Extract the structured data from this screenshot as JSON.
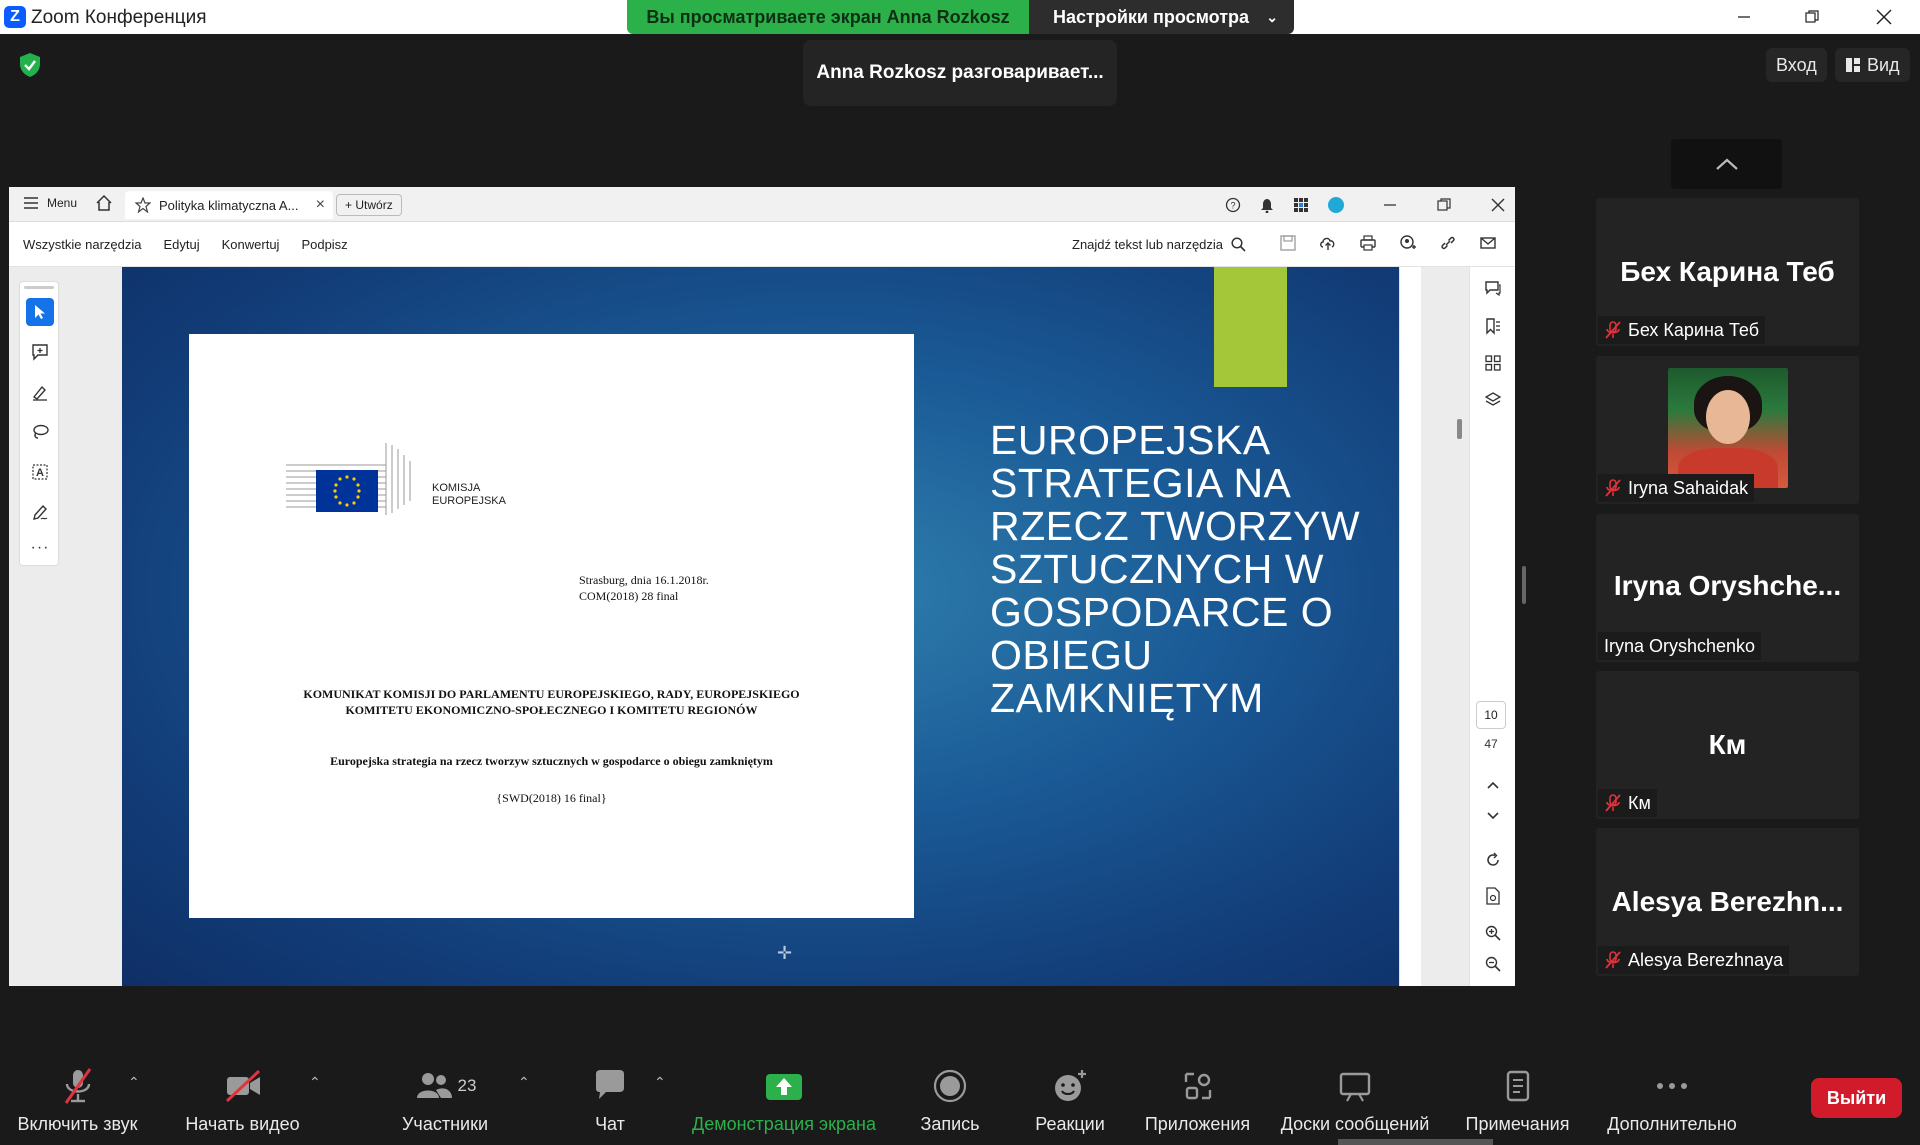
{
  "window": {
    "title": "Zoom Конференция"
  },
  "share_banner": {
    "viewing": "Вы просматриваете экран Anna Rozkosz",
    "view_settings": "Настройки просмотра"
  },
  "toast": {
    "speaking": "Anna Rozkosz разговаривает..."
  },
  "top_right": {
    "signin": "Вход",
    "view": "Вид"
  },
  "acrobat": {
    "menu": "Menu",
    "tab_title": "Polityka klimatyczna A...",
    "create": "Utwórz",
    "tools": [
      "Wszystkie narzędzia",
      "Edytuj",
      "Konwertuj",
      "Podpisz"
    ],
    "find_placeholder": "Znajdź tekst lub narzędzia",
    "page_current": "10",
    "page_total": "47"
  },
  "slide": {
    "title": "EUROPEJSKA STRATEGIA NA RZECZ TWORZYW SZTUCZNYCH W GOSPODARCE O OBIEGU ZAMKNIĘTYM",
    "accent_color": "#a4c639"
  },
  "document": {
    "logo_line1": "KOMISJA",
    "logo_line2": "EUROPEJSKA",
    "place_date": "Strasburg, dnia 16.1.2018r.",
    "doc_code": "COM(2018) 28 final",
    "heading": "KOMUNIKAT KOMISJI DO PARLAMENTU EUROPEJSKIEGO, RADY, EUROPEJSKIEGO KOMITETU EKONOMICZNO-SPOŁECZNEGO I KOMITETU REGIONÓW",
    "subtitle": "Europejska strategia na rzecz tworzyw sztucznych w gospodarce o obiegu zamkniętym",
    "reference": "{SWD(2018) 16 final}"
  },
  "participants_panel": {
    "tiles": [
      {
        "big": "Бех Карина Теб",
        "name": "Бех Карина Теб",
        "muted": true
      },
      {
        "big": "",
        "name": "Iryna Sahaidak",
        "muted": true,
        "has_video": true
      },
      {
        "big": "Iryna  Oryshche...",
        "name": "Iryna Oryshchenko",
        "muted": false
      },
      {
        "big": "Км",
        "name": "Км",
        "muted": true
      },
      {
        "big": "Alesya  Berezhn...",
        "name": "Alesya Berezhnaya",
        "muted": true
      }
    ]
  },
  "bottombar": {
    "unmute": "Включить звук",
    "start_video": "Начать видео",
    "participants": "Участники",
    "participants_count": "23",
    "chat": "Чат",
    "share": "Демонстрация экрана",
    "record": "Запись",
    "reactions": "Реакции",
    "apps": "Приложения",
    "whiteboards": "Доски сообщений",
    "notes": "Примечания",
    "more": "Дополнительно",
    "leave": "Выйти",
    "share_color": "#2cb14a",
    "leave_color": "#d21b2a"
  }
}
